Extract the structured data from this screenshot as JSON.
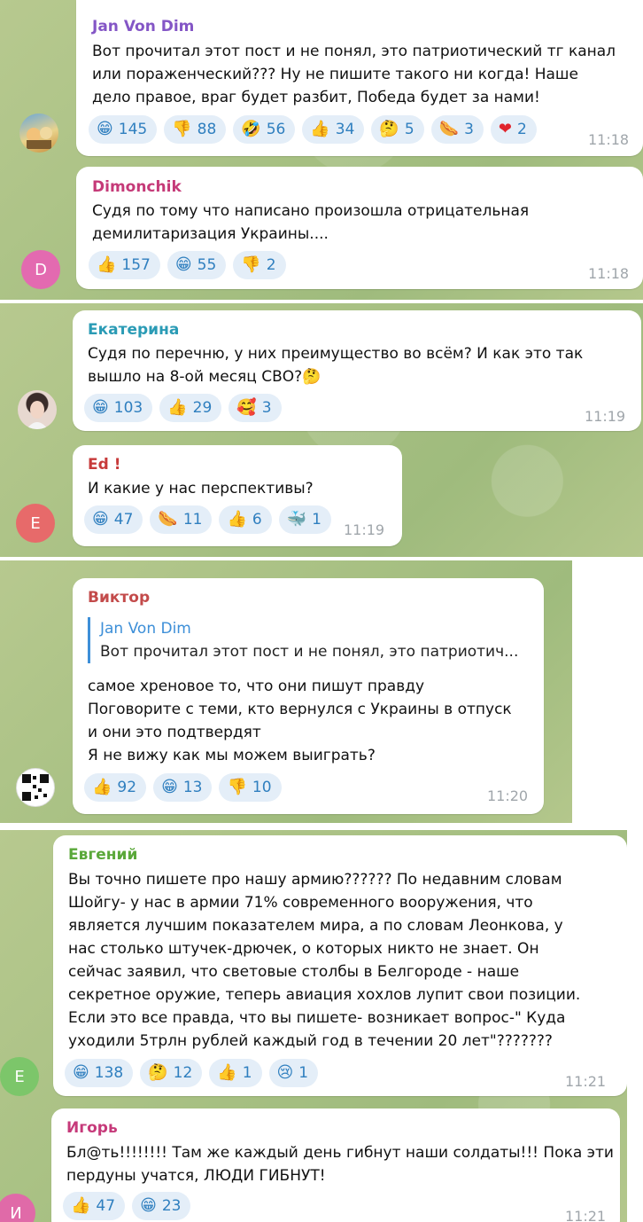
{
  "colors": {
    "reaction_bg": "#e4eef8",
    "reaction_text": "#2f7fbf",
    "name_jan": "#8456c6",
    "name_dimonchik": "#c53a78",
    "name_ekaterina": "#2a9bb5",
    "name_ed": "#c73a3a",
    "name_viktor": "#c34b4b",
    "name_evgeny": "#5aa83a",
    "name_igor": "#c63a7a"
  },
  "messages": [
    {
      "author": "Jan Von Dim",
      "lines": [
        "Вот прочитал этот пост и не понял, это патриотический тг канал",
        "или пораженческий??? Ну не пишите такого ни когда! Наше",
        "дело правое, враг будет разбит, Победа будет за нами!"
      ],
      "reactions": [
        {
          "emoji": "😁",
          "count": "145"
        },
        {
          "emoji": "👎",
          "count": "88"
        },
        {
          "emoji": "🤣",
          "count": "56"
        },
        {
          "emoji": "👍",
          "count": "34"
        },
        {
          "emoji": "🤔",
          "count": "5"
        },
        {
          "emoji": "🌭",
          "count": "3"
        },
        {
          "emoji": "❤",
          "count": "2"
        }
      ],
      "time": "11:18",
      "avatar_icon": "cartoon-avatar"
    },
    {
      "author": "Dimonchik",
      "lines": [
        "Судя по тому что написано произошла отрицательная",
        "демилитаризация Украины...."
      ],
      "reactions": [
        {
          "emoji": "👍",
          "count": "157"
        },
        {
          "emoji": "😁",
          "count": "55"
        },
        {
          "emoji": "👎",
          "count": "2"
        }
      ],
      "time": "11:18",
      "avatar_letter": "D"
    },
    {
      "author": "Екатерина",
      "lines": [
        "Судя по перечню, у них преимущество во всём? И как это так",
        "вышло на 8-ой месяц СВО?🤔"
      ],
      "reactions": [
        {
          "emoji": "😁",
          "count": "103"
        },
        {
          "emoji": "👍",
          "count": "29"
        },
        {
          "emoji": "🥰",
          "count": "3"
        }
      ],
      "time": "11:19",
      "avatar_icon": "photo-avatar"
    },
    {
      "author": "Ed !",
      "lines": [
        "И какие у нас перспективы?"
      ],
      "reactions": [
        {
          "emoji": "😁",
          "count": "47"
        },
        {
          "emoji": "🌭",
          "count": "11"
        },
        {
          "emoji": "👍",
          "count": "6"
        },
        {
          "emoji": "🐳",
          "count": "1"
        }
      ],
      "time": "11:19",
      "avatar_letter": "E"
    },
    {
      "author": "Виктор",
      "reply": {
        "author": "Jan Von Dim",
        "text": "Вот прочитал этот пост и не понял, это патриотич..."
      },
      "lines": [
        "самое хреновое то, что они пишут правду",
        "Поговорите с теми,  кто вернулся с Украины в отпуск",
        "и они это подтвердят",
        "Я не вижу как мы можем выиграть?"
      ],
      "reactions": [
        {
          "emoji": "👍",
          "count": "92"
        },
        {
          "emoji": "😁",
          "count": "13"
        },
        {
          "emoji": "👎",
          "count": "10"
        }
      ],
      "time": "11:20",
      "avatar_icon": "qr-avatar"
    },
    {
      "author": "Евгений",
      "lines": [
        "Вы точно пишете про нашу армию?????? По недавним словам",
        "Шойгу- у нас в армии 71% современного вооружения, что",
        "является лучшим показателем мира, а по словам Леонкова, у",
        "нас столько штучек-дрючек, о которых никто не знает. Он",
        "сейчас заявил, что световые столбы в Белгороде - наше",
        "секретное оружие, теперь авиация хохлов лупит свои позиции.",
        "Если это все правда, что вы пишете- возникает вопрос-\" Куда",
        "уходили 5трлн рублей каждый год в течении 20 лет\"???????"
      ],
      "reactions": [
        {
          "emoji": "😁",
          "count": "138"
        },
        {
          "emoji": "🤔",
          "count": "12"
        },
        {
          "emoji": "👍",
          "count": "1"
        },
        {
          "emoji": "😢",
          "count": "1"
        }
      ],
      "time": "11:21",
      "avatar_letter": "E"
    },
    {
      "author": "Игорь",
      "lines": [
        "Бл@ть!!!!!!!! Там же каждый день гибнут наши солдаты!!! Пока эти",
        "пердуны учатся, ЛЮДИ ГИБНУТ!"
      ],
      "reactions": [
        {
          "emoji": "👍",
          "count": "47"
        },
        {
          "emoji": "😁",
          "count": "23"
        }
      ],
      "time": "11:21",
      "avatar_letter": "И"
    }
  ]
}
